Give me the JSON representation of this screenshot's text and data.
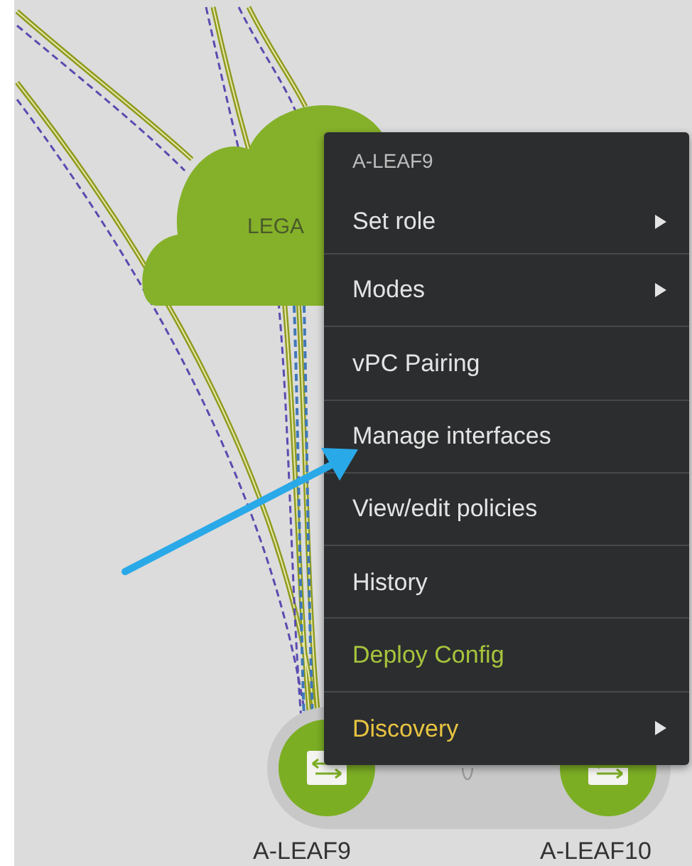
{
  "topology": {
    "cloud": {
      "label": "LEGA"
    },
    "nodes": [
      {
        "label": "A-LEAF9"
      },
      {
        "label": "A-LEAF10"
      }
    ]
  },
  "context_menu": {
    "title": "A-LEAF9",
    "items": [
      {
        "label": "Set role",
        "submenu": true,
        "color": "#e4e4e4"
      },
      {
        "label": "Modes",
        "submenu": true,
        "color": "#e4e4e4"
      },
      {
        "label": "vPC Pairing",
        "submenu": false,
        "color": "#e4e4e4"
      },
      {
        "label": "Manage interfaces",
        "submenu": false,
        "color": "#e4e4e4"
      },
      {
        "label": "View/edit policies",
        "submenu": false,
        "color": "#e4e4e4"
      },
      {
        "label": "History",
        "submenu": false,
        "color": "#e4e4e4"
      },
      {
        "label": "Deploy Config",
        "submenu": false,
        "color": "#a7c43c"
      },
      {
        "label": "Discovery",
        "submenu": true,
        "color": "#e8c441"
      }
    ]
  }
}
